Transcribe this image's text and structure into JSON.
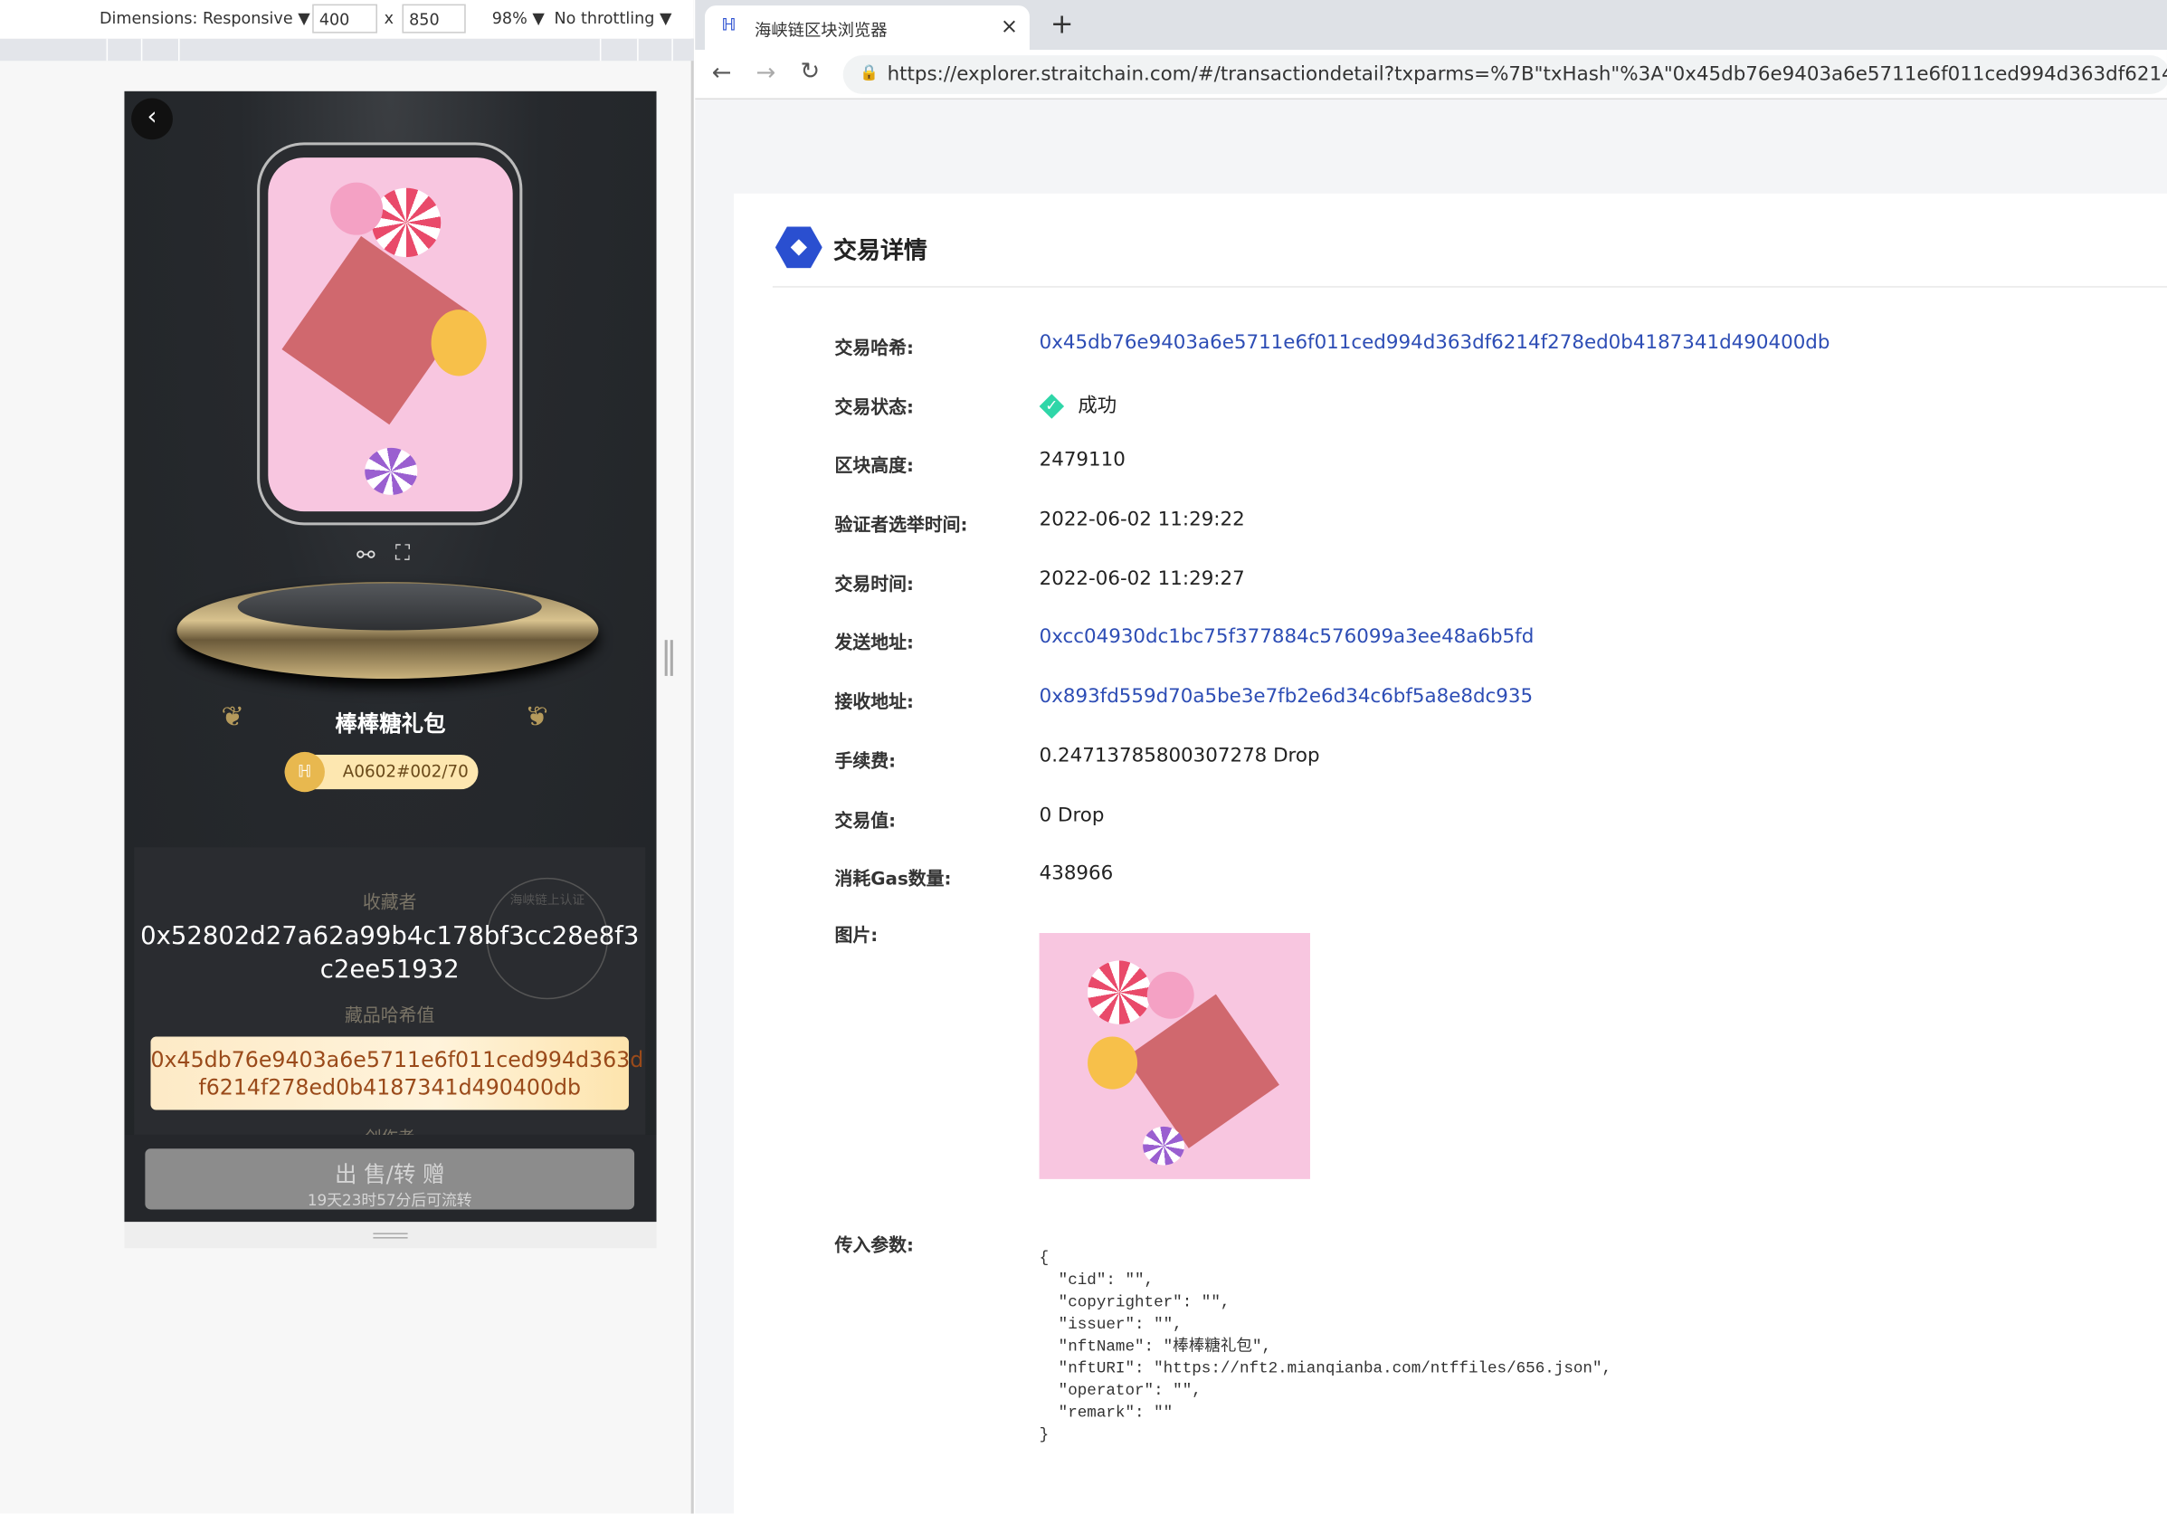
{
  "devtools": {
    "dimensions_label": "Dimensions: Responsive ▼",
    "width": "400",
    "times": "x",
    "height": "850",
    "zoom": "98% ▼",
    "throttling": "No throttling ▼"
  },
  "phone": {
    "nft_name": "棒棒糖礼包",
    "serial": "A0602#002/70",
    "collector_label": "收藏者",
    "collector_line1": "0x52802d27a62a99b4c178bf3cc28e8f3",
    "collector_line2": "c2ee51932",
    "stamp_text": "海峡链上认证",
    "hash_label": "藏品哈希值",
    "hash_line1": "0x45db76e9403a6e5711e6f011ced994d363d",
    "hash_line2": "f6214f278ed0b4187341d490400db",
    "creator_label": "创作者",
    "sell_button": "出 售/转 赠",
    "sell_sub": "19天23时57分后可流转"
  },
  "browser": {
    "tab_title": "海峡链区块浏览器",
    "tab_close": "×",
    "new_tab": "+",
    "url": "https://explorer.straitchain.com/#/transactiondetail?txparms=%7B\"txHash\"%3A\"0x45db76e9403a6e5711e6f011ced994d363df6214f278..."
  },
  "page": {
    "title": "交易详情",
    "rows": [
      {
        "label": "交易哈希:",
        "value": "0x45db76e9403a6e5711e6f011ced994d363df6214f278ed0b4187341d490400db",
        "link": true
      },
      {
        "label": "交易状态:",
        "value": "成功",
        "status": "success"
      },
      {
        "label": "区块高度:",
        "value": "2479110"
      },
      {
        "label": "验证者选举时间:",
        "value": "2022-06-02 11:29:22"
      },
      {
        "label": "交易时间:",
        "value": "2022-06-02 11:29:27"
      },
      {
        "label": "发送地址:",
        "value": "0xcc04930dc1bc75f377884c576099a3ee48a6b5fd",
        "link": true
      },
      {
        "label": "接收地址:",
        "value": "0x893fd559d70a5be3e7fb2e6d34c6bf5a8e8dc935",
        "link": true
      },
      {
        "label": "手续费:",
        "value": "0.24713785800307278 Drop"
      },
      {
        "label": "交易值:",
        "value": "0 Drop"
      },
      {
        "label": "消耗Gas数量:",
        "value": "438966"
      }
    ],
    "image_label": "图片:",
    "params_label": "传入参数:",
    "params": "{\n  \"cid\": \"\",\n  \"copyrighter\": \"\",\n  \"issuer\": \"\",\n  \"nftName\": \"棒棒糖礼包\",\n  \"nftURI\": \"https://nft2.mianqianba.com/ntffiles/656.json\",\n  \"operator\": \"\",\n  \"remark\": \"\"\n}"
  },
  "colors": {
    "link": "#2d4db5",
    "success": "#2fd6a8",
    "brand": "#2a4fd0",
    "hash_text": "#9a4a1a"
  }
}
